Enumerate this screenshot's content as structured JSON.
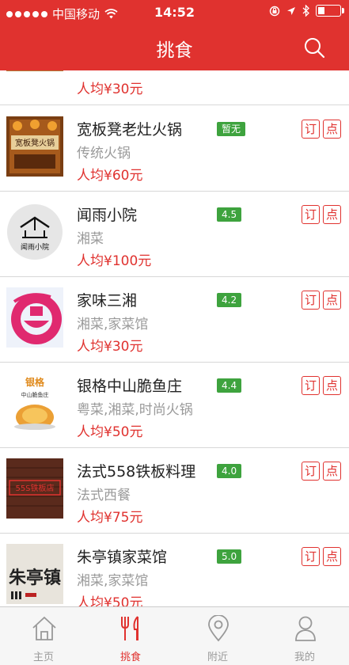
{
  "status_bar": {
    "carrier": "中国移动",
    "time": "14:52"
  },
  "nav": {
    "title": "挑食"
  },
  "restaurants": [
    {
      "name": "",
      "category": "",
      "price": "人均¥30元",
      "rating": ""
    },
    {
      "name": "宽板凳老灶火锅",
      "category": "传统火锅",
      "price": "人均¥60元",
      "rating": "暂无",
      "logo_text": "宽板凳火锅"
    },
    {
      "name": "闻雨小院",
      "category": "湘菜",
      "price": "人均¥100元",
      "rating": "4.5",
      "logo_text": "闻雨小院"
    },
    {
      "name": "家味三湘",
      "category": "湘菜,家菜馆",
      "price": "人均¥30元",
      "rating": "4.2"
    },
    {
      "name": "银格中山脆鱼庄",
      "category": "粤菜,湘菜,时尚火锅",
      "price": "人均¥50元",
      "rating": "4.4",
      "logo_text": "银格",
      "logo_sub": "中山脆鱼庄"
    },
    {
      "name": "法式558铁板料理",
      "category": "法式西餐",
      "price": "人均¥75元",
      "rating": "4.0",
      "logo_text": "55S铁板店"
    },
    {
      "name": "朱亭镇家菜馆",
      "category": "湘菜,家菜馆",
      "price": "人均¥50元",
      "rating": "5.0",
      "logo_text": "朱亭镇"
    }
  ],
  "buttons": {
    "order": "订",
    "dine": "点"
  },
  "tabs": [
    {
      "label": "主页",
      "icon": "home-icon"
    },
    {
      "label": "挑食",
      "icon": "fork-knife-icon",
      "active": true
    },
    {
      "label": "附近",
      "icon": "location-pin-icon"
    },
    {
      "label": "我的",
      "icon": "person-icon"
    }
  ],
  "colors": {
    "brand_red": "#e0322f",
    "rating_green": "#3ea33e"
  }
}
